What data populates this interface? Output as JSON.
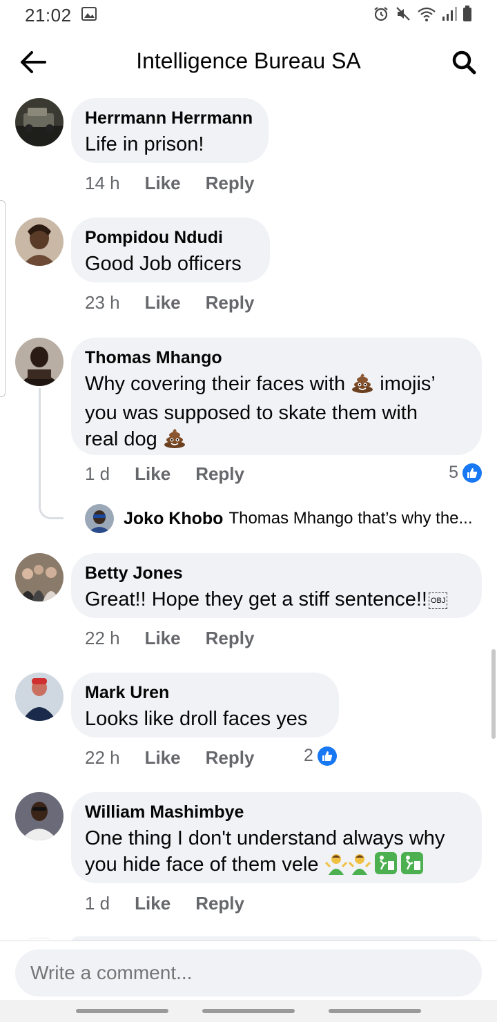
{
  "status_bar": {
    "time": "21:02"
  },
  "header": {
    "title": "Intelligence Bureau SA"
  },
  "comments": [
    {
      "author": "Herrmann Herrmann",
      "text": "Life in prison!",
      "time": "14 h",
      "like_label": "Like",
      "reply_label": "Reply"
    },
    {
      "author": "Pompidou Ndudi",
      "text": "Good Job officers",
      "time": "23 h",
      "like_label": "Like",
      "reply_label": "Reply"
    },
    {
      "author": "Thomas Mhango",
      "text_line1": "Why covering their faces with",
      "text_line1b": "imojis’",
      "text_line2": "you was supposed to skate them with",
      "text_line3": "real dog",
      "time": "1 d",
      "like_label": "Like",
      "reply_label": "Reply",
      "reaction_count": "5"
    },
    {
      "author": "Betty Jones",
      "text": "Great!! Hope they get a stiff sentence!!",
      "obj_glyph": "OBJ",
      "time": "22 h",
      "like_label": "Like",
      "reply_label": "Reply"
    },
    {
      "author": "Mark Uren",
      "text": "Looks like droll faces yes",
      "time": "22 h",
      "like_label": "Like",
      "reply_label": "Reply",
      "reaction_count": "2"
    },
    {
      "author": "William Mashimbye",
      "text_line1": "One thing I don't understand always why",
      "text_line2": "you hide face of them vele",
      "time": "1 d",
      "like_label": "Like",
      "reply_label": "Reply"
    }
  ],
  "reply_preview": {
    "author": "Joko Khobo",
    "text": "Thomas Mhango that’s why the..."
  },
  "composer": {
    "placeholder": "Write a comment..."
  },
  "colors": {
    "bubble": "#f0f2f5",
    "like_blue": "#1877f2",
    "meta_gray": "#65676b"
  }
}
